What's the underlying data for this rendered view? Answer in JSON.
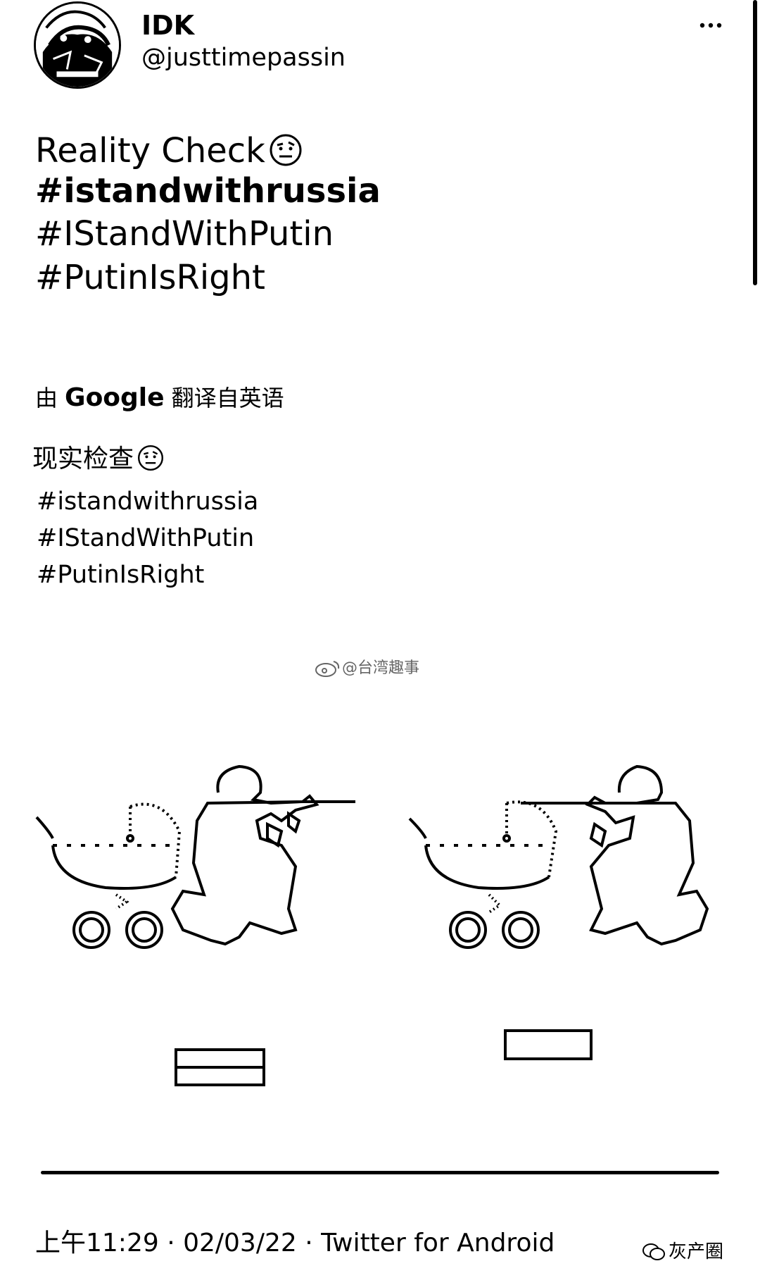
{
  "author": {
    "display_name": "IDK",
    "handle": "@justtimepassin",
    "avatar_icon": "sketch-portrait-avatar"
  },
  "tweet": {
    "title": "Reality Check",
    "title_emoji": "raised-eyebrow-face-icon",
    "hashtags": [
      "#istandwithrussia",
      "#IStandWithPutin",
      "#PutinIsRight"
    ]
  },
  "translation": {
    "prefix": "由",
    "provider": "Google",
    "suffix": "翻译自英语",
    "title": "现实检查",
    "hashtags": [
      "#istandwithrussia",
      "#IStandWithPutin",
      "#PutinIsRight"
    ]
  },
  "image_watermark": "@台湾趣事",
  "meta": {
    "timestamp": "上午11:29 · 02/03/22 · Twitter for Android"
  },
  "corner_watermark": "灰产圈",
  "more_icon": "more-options-icon",
  "colors": {
    "text": "#000000",
    "background": "#ffffff"
  }
}
